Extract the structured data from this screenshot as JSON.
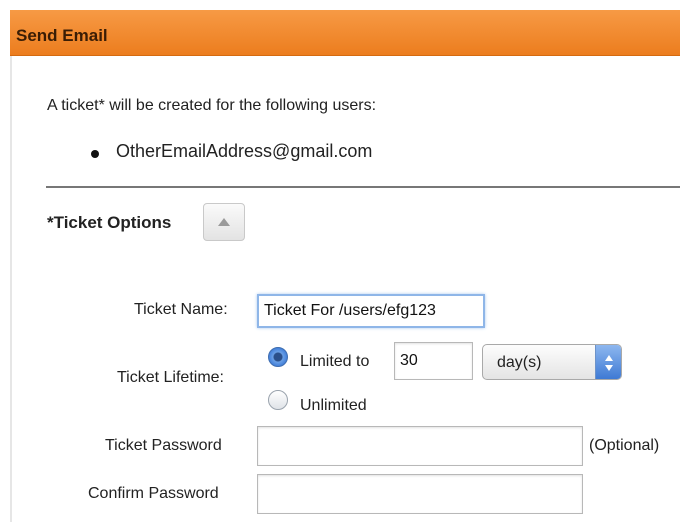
{
  "header": {
    "title": "Send Email"
  },
  "intro": {
    "text": "A ticket* will be created for the following users:"
  },
  "users": [
    "OtherEmailAddress@gmail.com"
  ],
  "ticket_options": {
    "title": "*Ticket Options",
    "collapse_icon": "chevron-up-icon"
  },
  "form": {
    "ticket_name": {
      "label": "Ticket Name:",
      "value": "Ticket For /users/efg123"
    },
    "ticket_lifetime": {
      "label": "Ticket Lifetime:",
      "limited_label": "Limited to",
      "limited_value": "30",
      "unit_selected": "day(s)",
      "unlimited_label": "Unlimited",
      "selected": "limited"
    },
    "ticket_password": {
      "label": "Ticket Password",
      "value": "",
      "hint": "(Optional)"
    },
    "confirm_password": {
      "label": "Confirm Password",
      "value": ""
    }
  },
  "colors": {
    "header": "#ec7d1e",
    "focus": "#8fb6e8",
    "radio_selected": "#3a78d6"
  }
}
